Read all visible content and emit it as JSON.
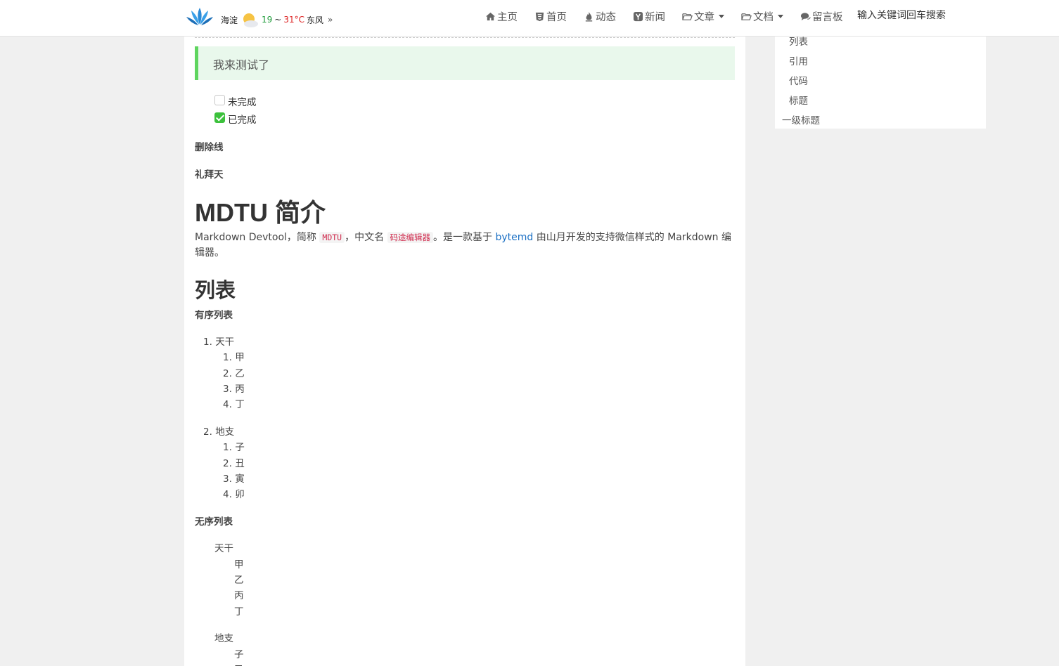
{
  "header": {
    "weather": {
      "city": "海淀",
      "low": "19",
      "sep": "~",
      "high": "31°C",
      "wind": "东风",
      "more": "»"
    },
    "nav": [
      {
        "icon": "home-icon",
        "label": "主页"
      },
      {
        "icon": "css3-icon",
        "label": "首页"
      },
      {
        "icon": "fire-icon",
        "label": "动态"
      },
      {
        "icon": "y-square-icon",
        "label": "新闻"
      },
      {
        "icon": "folder-open-icon",
        "label": "文章",
        "dropdown": true
      },
      {
        "icon": "folder-open-icon",
        "label": "文档",
        "dropdown": true
      },
      {
        "icon": "comments-icon",
        "label": "留言板"
      }
    ],
    "search_placeholder": "输入关键词回车搜索"
  },
  "article": {
    "quote": "我来测试了",
    "tasks": [
      {
        "label": "未完成",
        "checked": false
      },
      {
        "label": "已完成",
        "checked": true
      }
    ],
    "strike_label": "删除线",
    "sabbath_label": "礼拜天",
    "h1": "MDTU 简介",
    "intro": {
      "p1": "Markdown Devtool，简称",
      "code1": "MDTU",
      "p2": "，中文名",
      "code2": "码途编辑器",
      "p3": "。是一款基于",
      "link": "bytemd",
      "p4": "由山月开发的支持微信样式的 Markdown 编辑器。"
    },
    "h2_list": "列表",
    "ordered_label": "有序列表",
    "ordered": [
      {
        "num": "1.",
        "label": "天干",
        "children": [
          {
            "num": "1.",
            "label": "甲"
          },
          {
            "num": "2.",
            "label": "乙"
          },
          {
            "num": "3.",
            "label": "丙"
          },
          {
            "num": "4.",
            "label": "丁"
          }
        ]
      },
      {
        "num": "2.",
        "label": "地支",
        "children": [
          {
            "num": "1.",
            "label": "子"
          },
          {
            "num": "2.",
            "label": "丑"
          },
          {
            "num": "3.",
            "label": "寅"
          },
          {
            "num": "4.",
            "label": "卯"
          }
        ]
      }
    ],
    "unordered_label": "无序列表",
    "unordered": [
      {
        "label": "天干",
        "children": [
          "甲",
          "乙",
          "丙",
          "丁"
        ]
      },
      {
        "label": "地支",
        "children": [
          "子",
          "丑"
        ]
      }
    ]
  },
  "sidebar": {
    "toc": [
      "列表",
      "引用",
      "代码",
      "标题"
    ],
    "toc_top": "一级标题"
  }
}
